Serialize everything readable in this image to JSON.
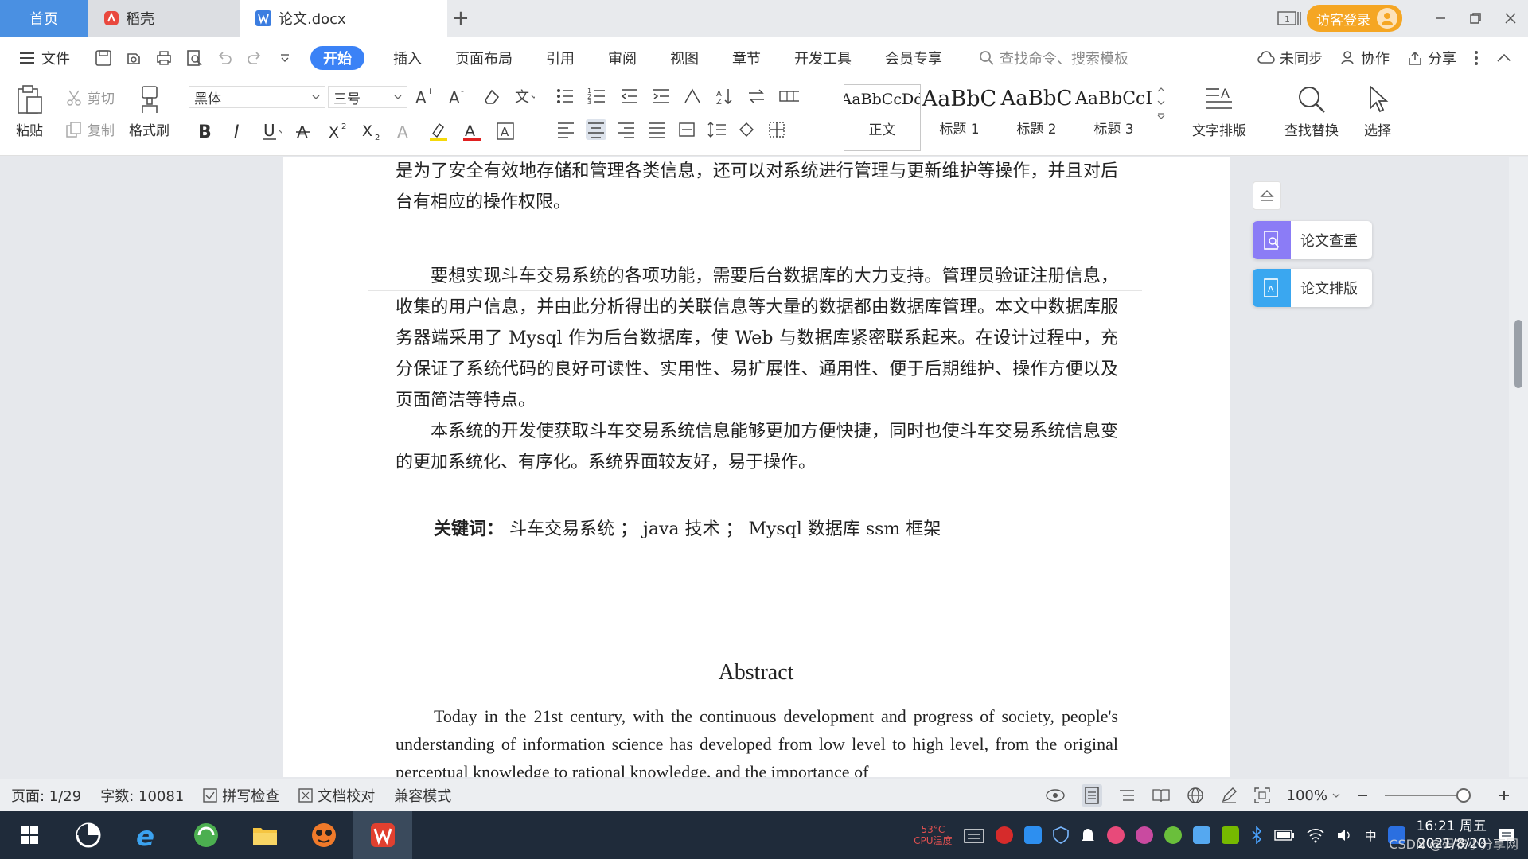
{
  "tabs": {
    "home": "首页",
    "daoke": "稻壳",
    "doc": "论文.docx",
    "add": "+"
  },
  "titlebar": {
    "login": "访客登录"
  },
  "menu": {
    "file": "文件",
    "tabs": [
      "开始",
      "插入",
      "页面布局",
      "引用",
      "审阅",
      "视图",
      "章节",
      "开发工具",
      "会员专享"
    ],
    "search": "查找命令、搜索模板",
    "sync": "未同步",
    "collab": "协作",
    "share": "分享"
  },
  "ribbon": {
    "paste": "粘贴",
    "cut": "剪切",
    "copy": "复制",
    "format_painter": "格式刷",
    "font_name": "黑体",
    "font_size": "三号",
    "styles": [
      {
        "sample": "AaBbCcDd",
        "label": "正文"
      },
      {
        "sample": "AaBbC",
        "label": "标题 1"
      },
      {
        "sample": "AaBbC",
        "label": "标题 2"
      },
      {
        "sample": "AaBbCcI",
        "label": "标题 3"
      }
    ],
    "text_layout": "文字排版",
    "find_replace": "查找替换",
    "select": "选择"
  },
  "document": {
    "para1": "汽车信息、公告信息、个人中心、后台管理、购物车、在线咨询；等功能。系统中管理员主要是为了安全有效地存储和管理各类信息，还可以对系统进行管理与更新维护等操作，并且对后台有相应的操作权限。",
    "para2": "要想实现斗车交易系统的各项功能，需要后台数据库的大力支持。管理员验证注册信息，收集的用户信息，并由此分析得出的关联信息等大量的数据都由数据库管理。本文中数据库服务器端采用了 Mysql 作为后台数据库，使 Web 与数据库紧密联系起来。在设计过程中，充分保证了系统代码的良好可读性、实用性、易扩展性、通用性、便于后期维护、操作方便以及页面简洁等特点。",
    "para3": "本系统的开发使获取斗车交易系统信息能够更加方便快捷，同时也使斗车交易系统信息变的更加系统化、有序化。系统界面较友好，易于操作。",
    "keywords_label": "关键词：",
    "keywords_text": "斗车交易系统  ； java 技术 ； Mysql 数据库   ssm 框架",
    "abstract_title": "Abstract",
    "abstract_text": "Today in the 21st century, with the continuous development and progress of society, people's understanding of information science has developed from low level to high level, from the original perceptual knowledge to rational knowledge, and the importance of"
  },
  "side_panel": {
    "check": "论文查重",
    "layout": "论文排版"
  },
  "status": {
    "page": "页面: 1/29",
    "words": "字数: 10081",
    "spell": "拼写检查",
    "proof": "文档校对",
    "compat": "兼容模式",
    "zoom": "100%"
  },
  "taskbar": {
    "time": "16:21 周五",
    "date": "2021/8/20",
    "ime": "中",
    "cpu": "CPU温度",
    "temp": "53°C"
  },
  "watermark": "CSDN @码农小分享网",
  "colors": {
    "accent": "#3b82f6",
    "home_tab": "#4a90e2",
    "login": "#f5a623",
    "side_check": "#8b7cf6",
    "side_layout": "#3aa7f0"
  }
}
